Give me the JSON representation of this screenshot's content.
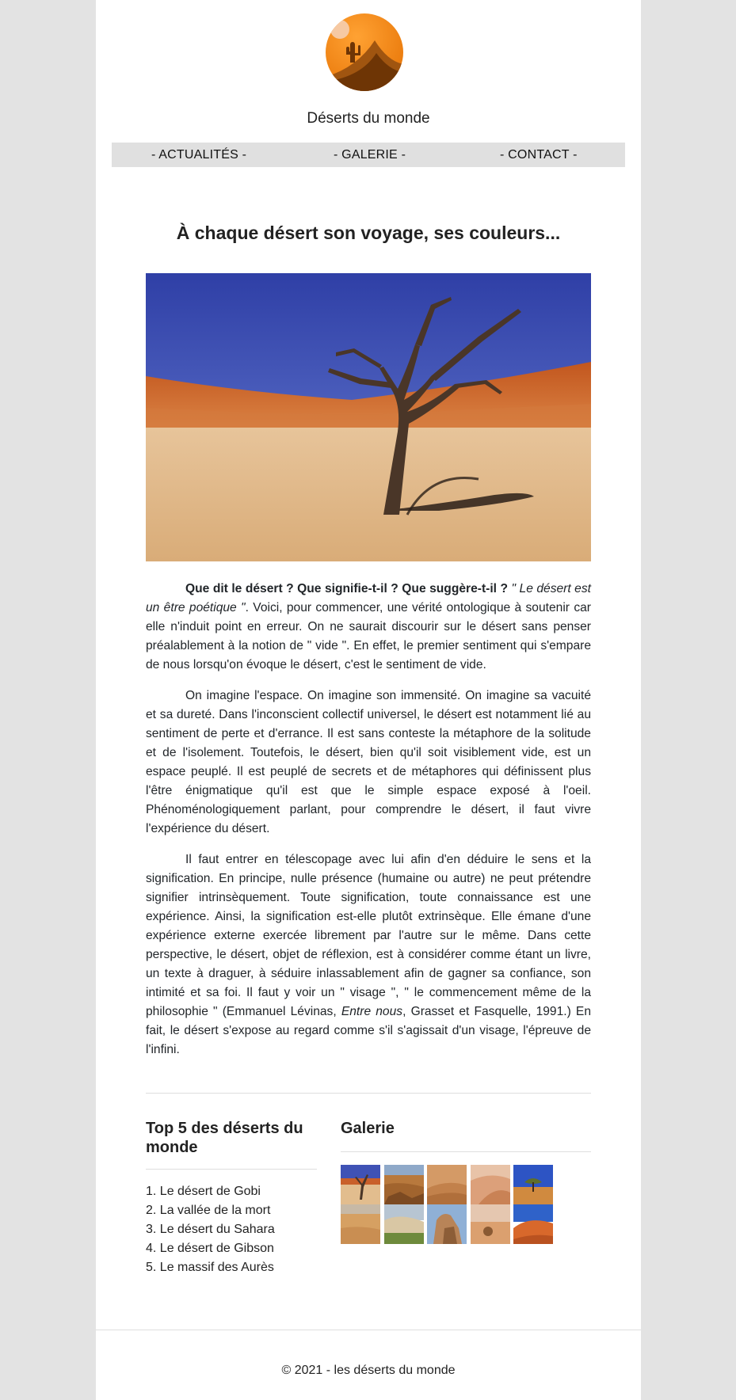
{
  "header": {
    "site_title": "Déserts du monde",
    "logo_icon": "desert-sun-cactus-logo",
    "logo_colors": {
      "sky": "#f7931e",
      "dune": "#7a3c05",
      "sun": "#f5c6a0"
    }
  },
  "nav": {
    "items": [
      {
        "label": "- ACTUALITÉS -"
      },
      {
        "label": "- GALERIE -"
      },
      {
        "label": "- CONTACT -"
      }
    ]
  },
  "main": {
    "headline": "À chaque désert son voyage, ses couleurs...",
    "hero_image": "dead-tree-desert-photo",
    "paragraphs": {
      "p1": {
        "bold": "Que dit le désert ? Que signifie-t-il ? Que suggère-t-il ?",
        "italic": " \" Le désert est un être poétique \"",
        "rest": ". Voici, pour commencer, une vérité ontologique à soutenir car elle n'induit point en erreur. On ne saurait discourir sur le désert sans penser préalablement à la notion de \" vide \". En effet, le premier sentiment qui s'empare de nous lorsqu'on évoque le désert, c'est le sentiment de vide."
      },
      "p2": "On imagine l'espace. On imagine son immensité. On imagine sa vacuité et sa dureté. Dans l'inconscient collectif universel, le désert est notamment lié au sentiment de perte et d'errance. Il est sans conteste la métaphore de la solitude et de l'isolement. Toutefois, le désert, bien qu'il soit visiblement vide, est un espace peuplé. Il est peuplé de secrets et de métaphores qui définissent plus l'être énigmatique qu'il est que le simple espace exposé à l'oeil. Phénoménologiquement parlant, pour comprendre le désert, il faut vivre l'expérience du désert.",
      "p3": {
        "before": "Il faut entrer en télescopage avec lui afin d'en déduire le sens et la signification. En principe, nulle présence (humaine ou autre) ne peut prétendre signifier intrinsèquement. Toute signification, toute connaissance est une expérience. Ainsi, la signification est-elle plutôt extrinsèque. Elle émane d'une expérience externe exercée librement par l'autre sur le même. Dans cette perspective, le désert, objet de réflexion, est à considérer comme étant un livre, un texte à draguer, à séduire inlassablement afin de gagner sa confiance, son intimité et sa foi. Il faut y voir un \" visage \", \" le commencement même de la philosophie \" (Emmanuel Lévinas, ",
        "italic": "Entre nous",
        "after": ", Grasset et Fasquelle, 1991.) En fait, le désert s'expose au regard comme s'il s'agissait d'un visage, l'épreuve de l'infini."
      }
    }
  },
  "top5": {
    "title": "Top 5 des déserts du monde",
    "items": [
      "1. Le désert de Gobi",
      "2. La vallée de la mort",
      "3. Le désert du Sahara",
      "4. Le désert de Gibson",
      "5. Le massif des Aurès"
    ]
  },
  "gallery": {
    "title": "Galerie",
    "thumbnails": [
      "dead-tree-thumbnail",
      "rocky-desert-thumbnail",
      "sand-dunes-thumbnail",
      "pink-dunes-thumbnail",
      "acacia-tree-thumbnail",
      "flat-sand-thumbnail",
      "green-dunes-thumbnail",
      "rock-formation-thumbnail",
      "desert-shrub-thumbnail",
      "red-dune-thumbnail"
    ]
  },
  "footer": {
    "copyright": "© 2021 - les déserts du monde"
  }
}
